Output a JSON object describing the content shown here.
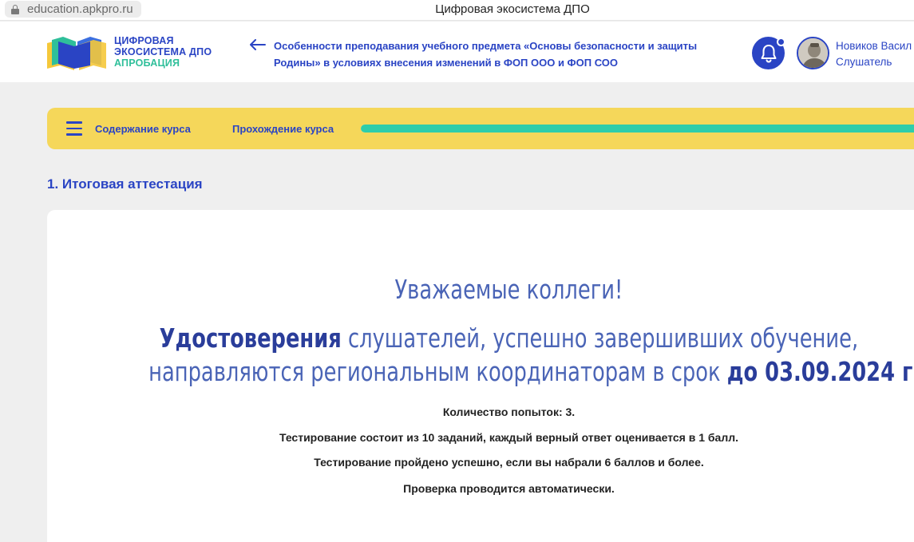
{
  "browser": {
    "url": "education.apkpro.ru",
    "tab_title": "Цифровая экосистема ДПО"
  },
  "header": {
    "logo": {
      "line1": "ЦИФРОВАЯ",
      "line2": "ЭКОСИСТЕМА ДПО",
      "line3": "АПРОБАЦИЯ"
    },
    "course_title": "Особенности преподавания учебного предмета «Основы безопасности и защиты Родины» в условиях внесения изменений в ФОП ООО и ФОП СОО",
    "user": {
      "name": "Новиков Васил",
      "role": "Слушатель"
    }
  },
  "course_bar": {
    "contents_label": "Содержание курса",
    "progress_label": "Прохождение курса",
    "progress_fraction": 1.0
  },
  "section": {
    "title": "1. Итоговая аттестация"
  },
  "notice": {
    "greeting": "Уважаемые коллеги!",
    "line1_bold": "Удостоверения",
    "line1_rest": " слушателей, успешно завершивших обучение,",
    "line2_start": "направляются региональным координаторам в срок ",
    "line2_bold": "до 03.09.2024 г."
  },
  "test_info": {
    "attempts": "Количество попыток: 3.",
    "structure": "Тестирование состоит из 10 заданий, каждый верный ответ оценивается в 1 балл.",
    "pass_rule": "Тестирование пройдено успешно, если вы набрали 6 баллов и более.",
    "check": "Проверка проводится автоматически."
  },
  "colors": {
    "brand_blue": "#2a44c4",
    "accent_green": "#2ecdaa",
    "bar_yellow": "#f5d75a",
    "page_bg": "#efefef"
  },
  "icons": [
    "lock-icon",
    "back-arrow-icon",
    "bell-icon",
    "menu-icon",
    "logo-book-icon"
  ]
}
